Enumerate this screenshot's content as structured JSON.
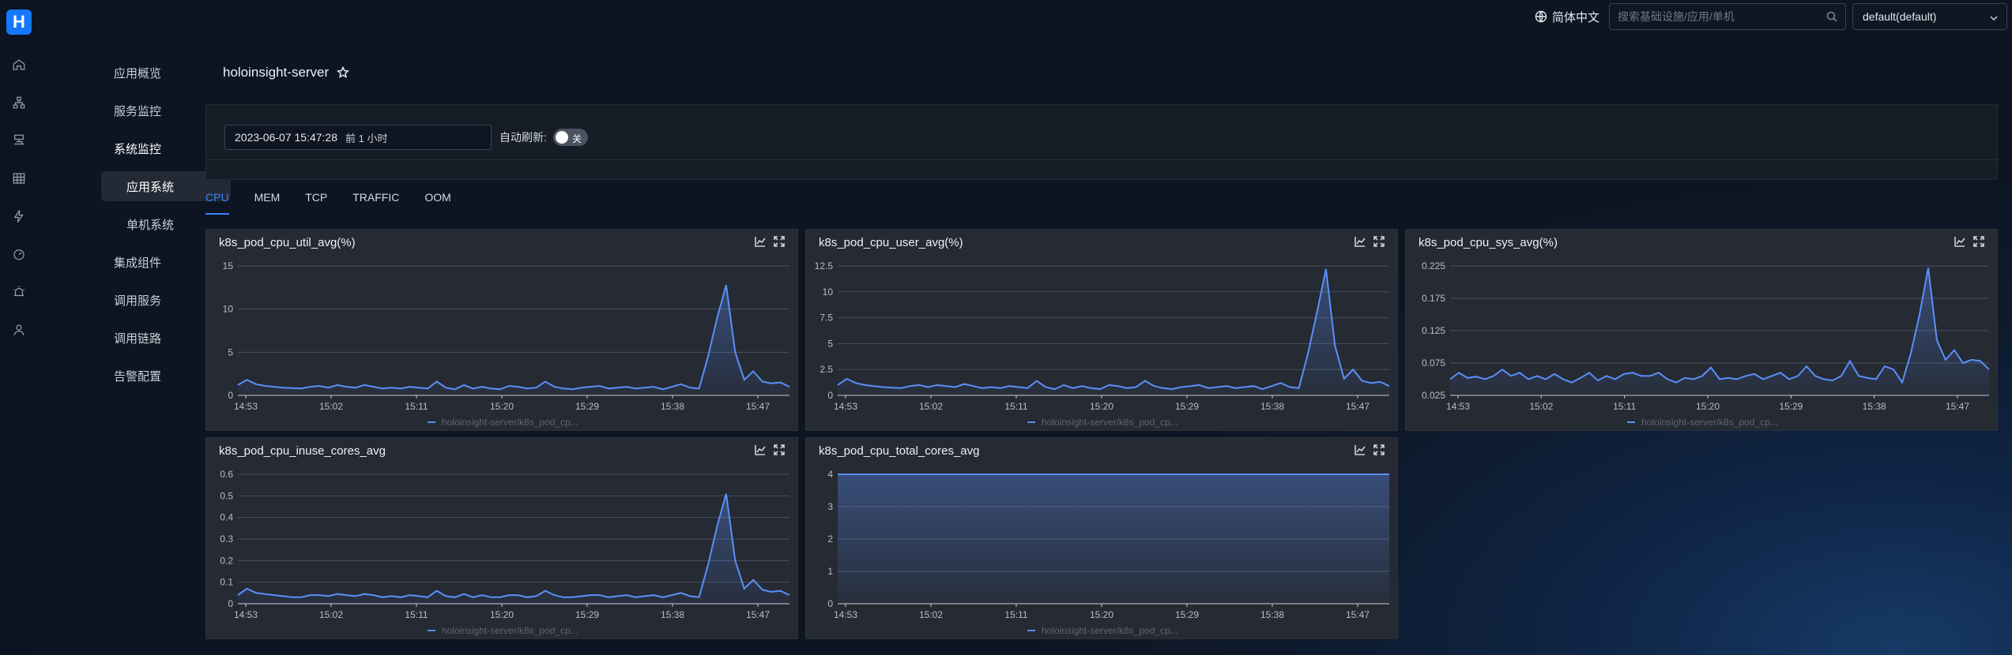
{
  "app": {
    "logo_letter": "H"
  },
  "header": {
    "language": "简体中文",
    "search_placeholder": "搜索基础设施/应用/单机",
    "tenant": "default(default)"
  },
  "sidebar": {
    "items": [
      {
        "label": "应用概览"
      },
      {
        "label": "服务监控",
        "chevron": "down"
      },
      {
        "label": "系统监控",
        "chevron": "up",
        "open": true
      },
      {
        "label": "应用系统",
        "sub": true,
        "selected": true
      },
      {
        "label": "单机系统",
        "sub": true
      },
      {
        "label": "集成组件",
        "chevron": "down"
      },
      {
        "label": "调用服务"
      },
      {
        "label": "调用链路"
      },
      {
        "label": "告警配置"
      }
    ],
    "rail_icons": [
      "home-icon",
      "topology-icon",
      "server-icon",
      "table-icon",
      "lightning-icon",
      "dashboard-icon",
      "alarm-icon",
      "user-icon"
    ]
  },
  "page": {
    "title": "holoinsight-server",
    "time_value": "2023-06-07 15:47:28",
    "time_relative": "前 1 小时",
    "auto_refresh_label": "自动刷新:",
    "toggle_off_label": "关"
  },
  "tabs": [
    {
      "label": "CPU",
      "active": true
    },
    {
      "label": "MEM"
    },
    {
      "label": "TCP"
    },
    {
      "label": "TRAFFIC"
    },
    {
      "label": "OOM"
    }
  ],
  "colors": {
    "accent": "#3b82f6",
    "series": "#5b8ff9"
  },
  "chart_data": [
    {
      "type": "area",
      "title": "k8s_pod_cpu_util_avg(%)",
      "x_ticks": [
        "14:53",
        "15:02",
        "15:11",
        "15:20",
        "15:29",
        "15:38",
        "15:47"
      ],
      "y_ticks": [
        "0",
        "5",
        "10",
        "15"
      ],
      "ylim": [
        0,
        15
      ],
      "series": [
        {
          "name": "holoinsight-server/k8s_pod_cp...",
          "values": [
            1.2,
            1.8,
            1.3,
            1.1,
            1.0,
            0.9,
            0.85,
            0.8,
            1.0,
            1.1,
            0.9,
            1.2,
            1.0,
            0.9,
            1.2,
            1.0,
            0.8,
            0.9,
            0.8,
            1.0,
            0.9,
            0.8,
            1.6,
            0.9,
            0.7,
            1.2,
            0.8,
            1.0,
            0.8,
            0.7,
            1.1,
            1.0,
            0.8,
            0.9,
            1.6,
            1.0,
            0.8,
            0.7,
            0.9,
            1.0,
            1.1,
            0.8,
            0.9,
            1.0,
            0.8,
            0.9,
            1.0,
            0.7,
            1.0,
            1.3,
            0.9,
            0.8,
            4.5,
            9.0,
            12.8,
            5.0,
            1.8,
            2.8,
            1.6,
            1.4,
            1.5,
            1.0
          ]
        }
      ],
      "legend": "bottom-center"
    },
    {
      "type": "area",
      "title": "k8s_pod_cpu_user_avg(%)",
      "x_ticks": [
        "14:53",
        "15:02",
        "15:11",
        "15:20",
        "15:29",
        "15:38",
        "15:47"
      ],
      "y_ticks": [
        "0",
        "2.5",
        "5",
        "7.5",
        "10",
        "12.5"
      ],
      "ylim": [
        0,
        12.5
      ],
      "series": [
        {
          "name": "holoinsight-server/k8s_pod_cp...",
          "values": [
            1.0,
            1.6,
            1.2,
            1.0,
            0.9,
            0.8,
            0.75,
            0.7,
            0.9,
            1.0,
            0.8,
            1.0,
            0.9,
            0.8,
            1.1,
            0.9,
            0.7,
            0.8,
            0.7,
            0.9,
            0.8,
            0.7,
            1.4,
            0.8,
            0.6,
            1.0,
            0.7,
            0.9,
            0.7,
            0.6,
            1.0,
            0.9,
            0.7,
            0.8,
            1.4,
            0.9,
            0.7,
            0.6,
            0.8,
            0.9,
            1.0,
            0.7,
            0.8,
            0.9,
            0.7,
            0.8,
            0.9,
            0.6,
            0.9,
            1.2,
            0.8,
            0.7,
            4.0,
            8.0,
            12.2,
            4.8,
            1.6,
            2.5,
            1.4,
            1.2,
            1.3,
            0.9
          ]
        }
      ],
      "legend": "bottom-center"
    },
    {
      "type": "area",
      "title": "k8s_pod_cpu_sys_avg(%)",
      "x_ticks": [
        "14:53",
        "15:02",
        "15:11",
        "15:20",
        "15:29",
        "15:38",
        "15:47"
      ],
      "y_ticks": [
        "0.025",
        "0.075",
        "0.125",
        "0.175",
        "0.225"
      ],
      "ylim": [
        0.025,
        0.225
      ],
      "series": [
        {
          "name": "holoinsight-server/k8s_pod_cp...",
          "values": [
            0.05,
            0.06,
            0.052,
            0.054,
            0.05,
            0.055,
            0.065,
            0.055,
            0.06,
            0.05,
            0.055,
            0.05,
            0.058,
            0.05,
            0.045,
            0.052,
            0.06,
            0.048,
            0.055,
            0.05,
            0.058,
            0.06,
            0.055,
            0.055,
            0.06,
            0.05,
            0.045,
            0.052,
            0.05,
            0.055,
            0.068,
            0.05,
            0.052,
            0.05,
            0.055,
            0.058,
            0.05,
            0.055,
            0.06,
            0.05,
            0.055,
            0.07,
            0.055,
            0.05,
            0.048,
            0.055,
            0.078,
            0.055,
            0.052,
            0.05,
            0.07,
            0.065,
            0.045,
            0.09,
            0.15,
            0.222,
            0.11,
            0.08,
            0.095,
            0.075,
            0.08,
            0.078,
            0.065
          ]
        }
      ],
      "legend": "bottom-center"
    },
    {
      "type": "area",
      "title": "k8s_pod_cpu_inuse_cores_avg",
      "x_ticks": [
        "14:53",
        "15:02",
        "15:11",
        "15:20",
        "15:29",
        "15:38",
        "15:47"
      ],
      "y_ticks": [
        "0",
        "0.1",
        "0.2",
        "0.3",
        "0.4",
        "0.5",
        "0.6"
      ],
      "ylim": [
        0,
        0.6
      ],
      "series": [
        {
          "name": "holoinsight-server/k8s_pod_cp...",
          "values": [
            0.04,
            0.07,
            0.05,
            0.045,
            0.04,
            0.035,
            0.03,
            0.03,
            0.04,
            0.04,
            0.035,
            0.045,
            0.04,
            0.035,
            0.045,
            0.04,
            0.03,
            0.035,
            0.03,
            0.04,
            0.035,
            0.03,
            0.06,
            0.035,
            0.03,
            0.045,
            0.03,
            0.04,
            0.03,
            0.03,
            0.04,
            0.04,
            0.03,
            0.035,
            0.06,
            0.04,
            0.03,
            0.03,
            0.035,
            0.04,
            0.04,
            0.03,
            0.035,
            0.04,
            0.03,
            0.035,
            0.04,
            0.03,
            0.04,
            0.05,
            0.035,
            0.03,
            0.18,
            0.36,
            0.51,
            0.2,
            0.07,
            0.11,
            0.065,
            0.055,
            0.06,
            0.04
          ]
        }
      ],
      "legend": "bottom-center"
    },
    {
      "type": "area",
      "title": "k8s_pod_cpu_total_cores_avg",
      "x_ticks": [
        "14:53",
        "15:02",
        "15:11",
        "15:20",
        "15:29",
        "15:38",
        "15:47"
      ],
      "y_ticks": [
        "0",
        "1",
        "2",
        "3",
        "4"
      ],
      "ylim": [
        0,
        4
      ],
      "series": [
        {
          "name": "holoinsight-server/k8s_pod_cp...",
          "values": [
            4,
            4,
            4,
            4,
            4,
            4,
            4,
            4,
            4,
            4,
            4,
            4,
            4,
            4,
            4,
            4,
            4,
            4,
            4,
            4,
            4,
            4,
            4,
            4,
            4,
            4,
            4,
            4,
            4,
            4,
            4,
            4,
            4,
            4,
            4,
            4,
            4,
            4,
            4,
            4,
            4,
            4,
            4,
            4,
            4,
            4,
            4,
            4,
            4,
            4,
            4,
            4,
            4,
            4,
            4,
            4,
            4,
            4,
            4,
            4,
            4,
            4
          ]
        }
      ],
      "legend": "bottom-center"
    }
  ]
}
